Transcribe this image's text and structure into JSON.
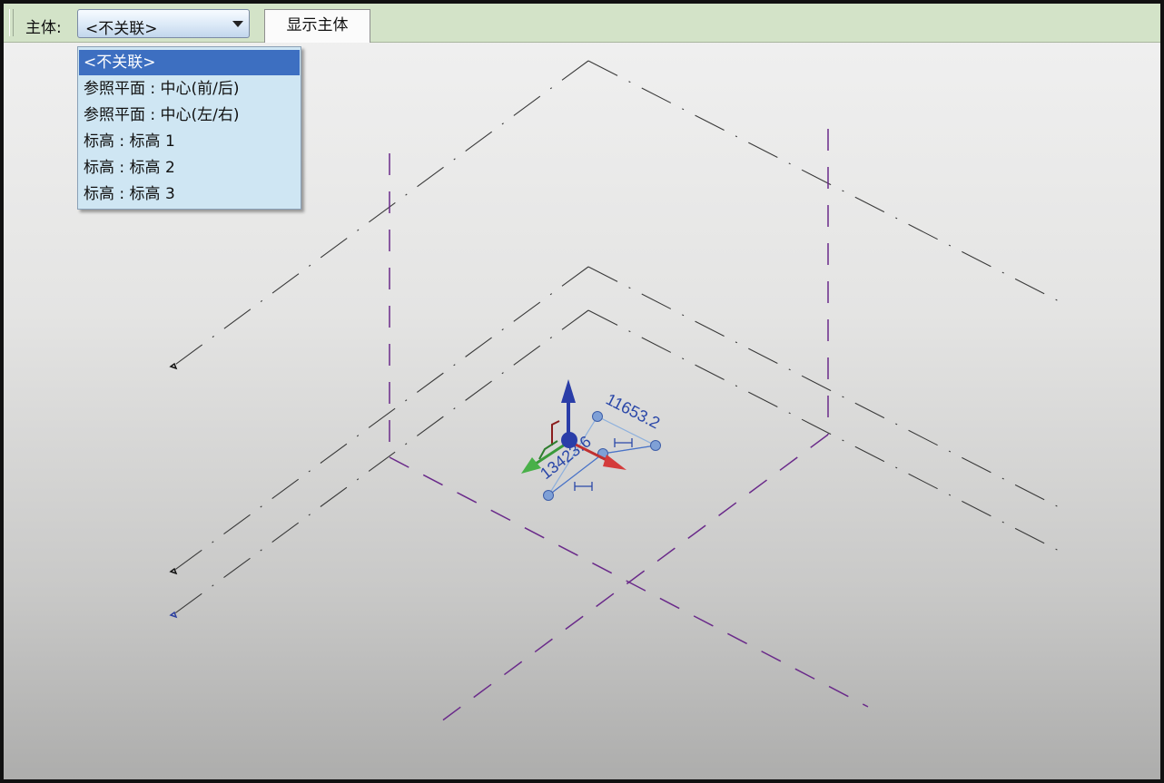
{
  "options_bar": {
    "host_label": "主体:",
    "host_select_value": "<不关联>",
    "show_host_button": "显示主体"
  },
  "host_dropdown": {
    "items": [
      {
        "label": "<不关联>",
        "selected": true
      },
      {
        "label": "参照平面 : 中心(前/后)",
        "selected": false
      },
      {
        "label": "参照平面 : 中心(左/右)",
        "selected": false
      },
      {
        "label": "标高 : 标高 1",
        "selected": false
      },
      {
        "label": "标高 : 标高 2",
        "selected": false
      },
      {
        "label": "标高 : 标高 3",
        "selected": false
      }
    ]
  },
  "viewport": {
    "dimension_long": "11653.2",
    "dimension_short": "13423.6"
  },
  "colors": {
    "options_bar_bg": "#d3e3c8",
    "dropdown_bg": "#cfe6f3",
    "dropdown_selected": "#3d6fc1",
    "reference_plane": "#6a2a8a",
    "level_lines": "#303030",
    "dimension_text": "#2a47a8"
  },
  "icons": [
    "dropdown-arrow-icon",
    "move-gizmo-icon",
    "level-end-marker-icon"
  ]
}
